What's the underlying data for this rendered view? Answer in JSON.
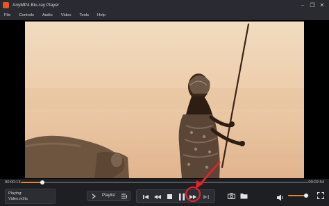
{
  "window": {
    "title": "AnyMP4 Blu-ray Player",
    "controls": {
      "minimize": "–",
      "restore": "❐",
      "close": "✕"
    }
  },
  "menu": {
    "items": [
      "File",
      "Controls",
      "Audio",
      "Video",
      "Tools",
      "Help"
    ]
  },
  "player": {
    "elapsed": "00:00:13",
    "duration": "00:02:54",
    "progress_fraction": 0.076,
    "now_playing_label": "Playing:",
    "file_name": "Video.m2ts",
    "playlist_label": "Playlist",
    "volume_fraction": 0.85
  },
  "icons": {
    "app": "app-logo-icon",
    "playlist_left": "playlist-toggle-icon",
    "playlist_right": "playlist-menu-icon",
    "transport": [
      "skip-previous-icon",
      "rewind-icon",
      "stop-icon",
      "pause-icon",
      "fast-forward-icon",
      "skip-next-icon"
    ],
    "tools": [
      "snapshot-icon",
      "folder-icon"
    ],
    "volume": "volume-icon",
    "fullscreen": "fullscreen-icon"
  },
  "colors": {
    "accent": "#e8822e",
    "highlight": "#e0232a",
    "background": "#1e1f23"
  }
}
